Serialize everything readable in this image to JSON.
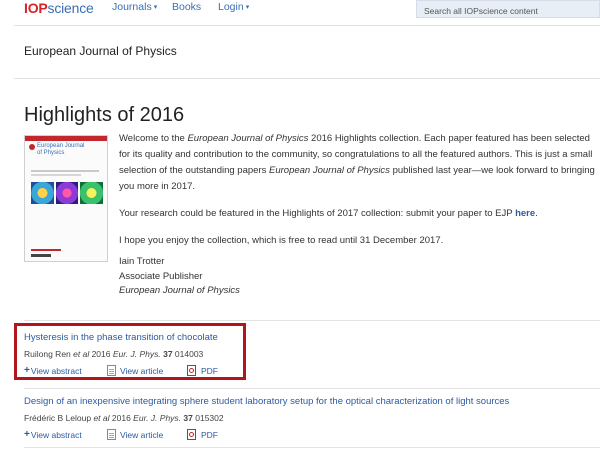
{
  "nav": {
    "logo_iop": "IOP",
    "logo_science": "science",
    "items": [
      {
        "label": "Journals",
        "caret": "▾"
      },
      {
        "label": "Books",
        "caret": ""
      },
      {
        "label": "Login",
        "caret": "▾"
      }
    ],
    "search_placeholder": "Search all IOPscience content"
  },
  "journal_title": "European Journal of Physics",
  "page_title": "Highlights of 2016",
  "cover": {
    "title_line1": "European Journal",
    "title_line2": "of Physics"
  },
  "intro": {
    "p1_a": "Welcome to the ",
    "p1_journal": "European Journal of Physics",
    "p1_b": " 2016 Highlights collection. Each paper featured has been selected for its quality and contribution to the community, so congratulations to all the featured authors. This is just a small selection of the outstanding papers ",
    "p1_journal2": "European Journal of Physics",
    "p1_c": " published last year—we look forward to bringing you more in 2017.",
    "p2_a": "Your research could be featured in the Highlights of 2017 collection: submit your paper to EJP ",
    "p2_link": "here",
    "p2_b": ".",
    "p3": "I hope you enjoy the collection, which is free to read until 31 December 2017."
  },
  "signature": {
    "name": "Iain Trotter",
    "role": "Associate Publisher",
    "journal": "European Journal of Physics"
  },
  "articles": [
    {
      "title": "Hysteresis in the phase transition of chocolate",
      "authors": "Ruilong Ren ",
      "etal": "et al",
      "year": " 2016 ",
      "journal": "Eur. J. Phys.",
      "volume": " 37",
      "page": " 014003",
      "view_abstract": "View abstract",
      "view_article": "View article",
      "pdf": "PDF"
    },
    {
      "title": "Design of an inexpensive integrating sphere student laboratory setup for the optical characterization of light sources",
      "authors": "Frédéric B Leloup ",
      "etal": "et al",
      "year": " 2016 ",
      "journal": "Eur. J. Phys.",
      "volume": " 37",
      "page": " 015302",
      "view_abstract": "View abstract",
      "view_article": "View article",
      "pdf": "PDF"
    }
  ],
  "colors": {
    "link": "#2c5aa0",
    "brand_red": "#d9222a",
    "highlight_box": "#b2161d"
  }
}
